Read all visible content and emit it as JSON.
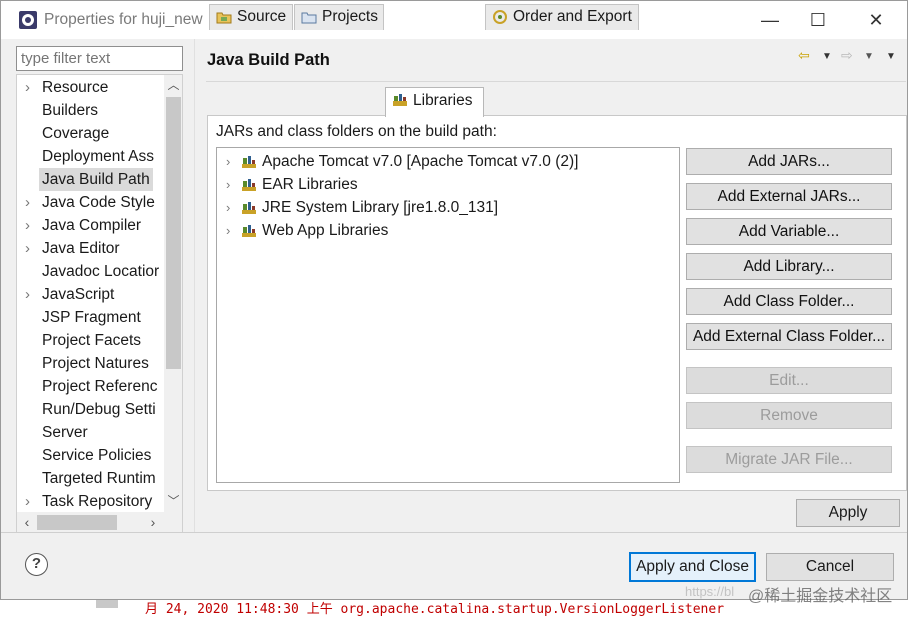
{
  "window": {
    "title": "Properties for huji_new",
    "controls": {
      "minimize": "—",
      "maximize": "☐",
      "close": "✕"
    }
  },
  "filter": {
    "placeholder": "type filter text"
  },
  "nav_tree": {
    "items": [
      {
        "label": "Resource",
        "expandable": true
      },
      {
        "label": "Builders",
        "expandable": false
      },
      {
        "label": "Coverage",
        "expandable": false
      },
      {
        "label": "Deployment Ass",
        "expandable": false
      },
      {
        "label": "Java Build Path",
        "expandable": false,
        "selected": true
      },
      {
        "label": "Java Code Style",
        "expandable": true
      },
      {
        "label": "Java Compiler",
        "expandable": true
      },
      {
        "label": "Java Editor",
        "expandable": true
      },
      {
        "label": "Javadoc Locatior",
        "expandable": false
      },
      {
        "label": "JavaScript",
        "expandable": true
      },
      {
        "label": "JSP Fragment",
        "expandable": false
      },
      {
        "label": "Project Facets",
        "expandable": false
      },
      {
        "label": "Project Natures",
        "expandable": false
      },
      {
        "label": "Project Referenc",
        "expandable": false
      },
      {
        "label": "Run/Debug Setti",
        "expandable": false
      },
      {
        "label": "Server",
        "expandable": false
      },
      {
        "label": "Service Policies",
        "expandable": false
      },
      {
        "label": "Targeted Runtim",
        "expandable": false
      },
      {
        "label": "Task Repository",
        "expandable": true
      }
    ]
  },
  "page": {
    "title": "Java Build Path",
    "tabs": [
      {
        "label": "Source"
      },
      {
        "label": "Projects"
      },
      {
        "label": "Libraries",
        "active": true
      },
      {
        "label": "Order and Export"
      }
    ],
    "caption": "JARs and class folders on the build path:",
    "libraries": [
      {
        "label": "Apache Tomcat v7.0 [Apache Tomcat v7.0 (2)]"
      },
      {
        "label": "EAR Libraries"
      },
      {
        "label": "JRE System Library [jre1.8.0_131]"
      },
      {
        "label": "Web App Libraries"
      }
    ],
    "buttons": {
      "add_jars": "Add JARs...",
      "add_external_jars": "Add External JARs...",
      "add_variable": "Add Variable...",
      "add_library": "Add Library...",
      "add_class_folder": "Add Class Folder...",
      "add_external_class_folder": "Add External Class Folder...",
      "edit": "Edit...",
      "remove": "Remove",
      "migrate_jar": "Migrate JAR File..."
    },
    "apply": "Apply"
  },
  "footer": {
    "help": "?",
    "apply_and_close": "Apply and Close",
    "cancel": "Cancel"
  },
  "background": {
    "watermark": "@稀土掘金技术社区",
    "watermark_url": "https://bl",
    "red_text": "月 24, 2020 11:48:30 上午 org.apache.catalina.startup.VersionLoggerListener"
  },
  "colors": {
    "accent": "#0078d7",
    "selection": "#dadada",
    "library_icon": "#6b8e23"
  }
}
